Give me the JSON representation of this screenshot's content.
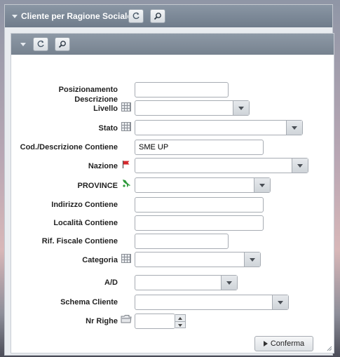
{
  "header": {
    "title": "Cliente per Ragione Sociale"
  },
  "form": {
    "posizionamento_label": "Posizionamento",
    "descrizione_livello_label_1": "Descrizione",
    "descrizione_livello_label_2": "Livello",
    "stato_label": "Stato",
    "cod_descrizione_label": "Cod./Descrizione Contiene",
    "cod_descrizione_value": "SME UP",
    "nazione_label": "Nazione",
    "province_label": "PROVINCE",
    "indirizzo_label": "Indirizzo Contiene",
    "localita_label": "Località Contiene",
    "rif_fiscale_label": "Rif. Fiscale Contiene",
    "categoria_label": "Categoria",
    "ad_label": "A/D",
    "schema_cliente_label": "Schema Cliente",
    "nr_righe_label": "Nr Righe"
  },
  "buttons": {
    "conferma_label": "Conferma"
  },
  "icons": {
    "refresh": "refresh-icon",
    "search": "magnifier-icon",
    "table": "table-icon",
    "flag": "flag-icon",
    "italy": "italy-map-icon",
    "folder": "folder-icon"
  },
  "colors": {
    "header": "#76828f",
    "panel": "#e9ecf0"
  }
}
